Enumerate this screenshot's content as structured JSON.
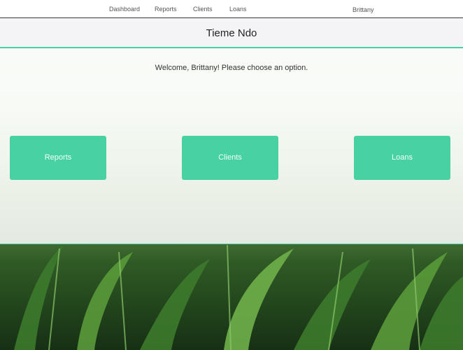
{
  "nav": {
    "links": [
      "Dashboard",
      "Reports",
      "Clients",
      "Loans"
    ],
    "user": "Brittany"
  },
  "brand": {
    "title": "Tieme Ndo"
  },
  "welcome": {
    "message": "Welcome, Brittany! Please choose an option."
  },
  "tiles": [
    "Reports",
    "Clients",
    "Loans"
  ],
  "colors": {
    "accent": "#48d1a3",
    "panel": "#ffffff",
    "text": "#333333"
  }
}
